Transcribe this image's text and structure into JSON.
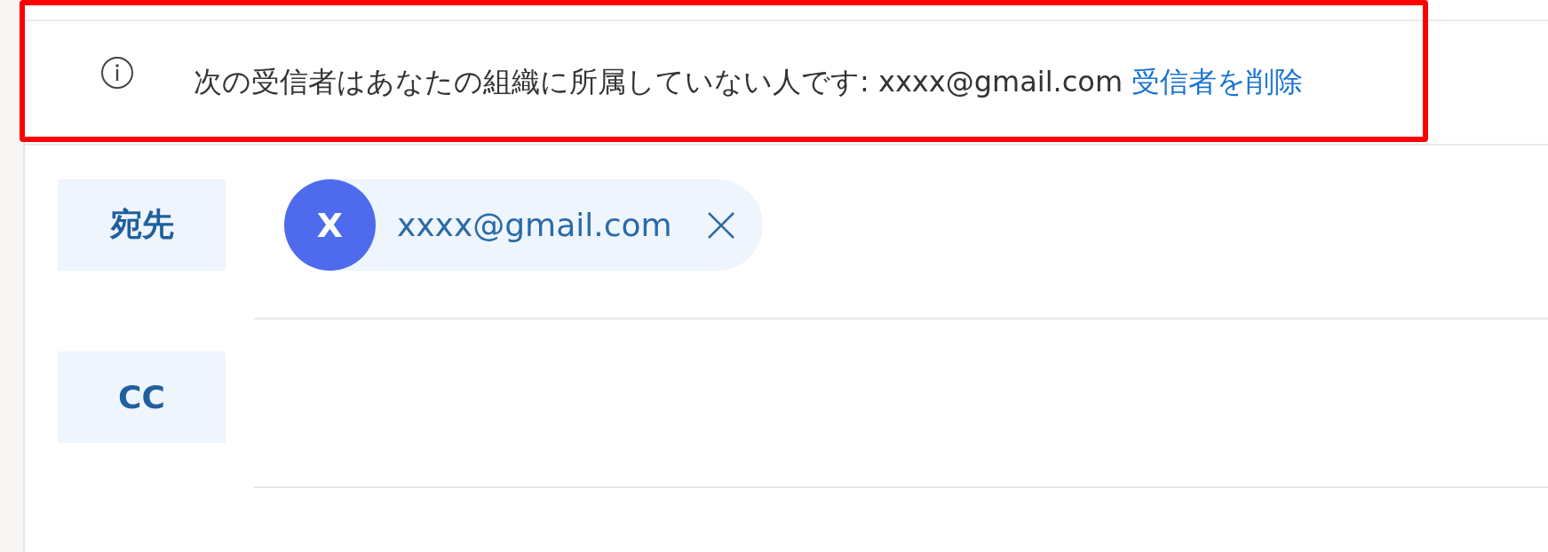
{
  "banner": {
    "message": "次の受信者はあなたの組織に所属していない人です: xxxx@gmail.com",
    "action_link": "受信者を削除",
    "highlighted": true
  },
  "to_field": {
    "label": "宛先",
    "recipients": [
      {
        "initial": "X",
        "address": "xxxx@gmail.com",
        "color": "#4f6bed"
      }
    ]
  },
  "cc_field": {
    "label": "CC"
  }
}
